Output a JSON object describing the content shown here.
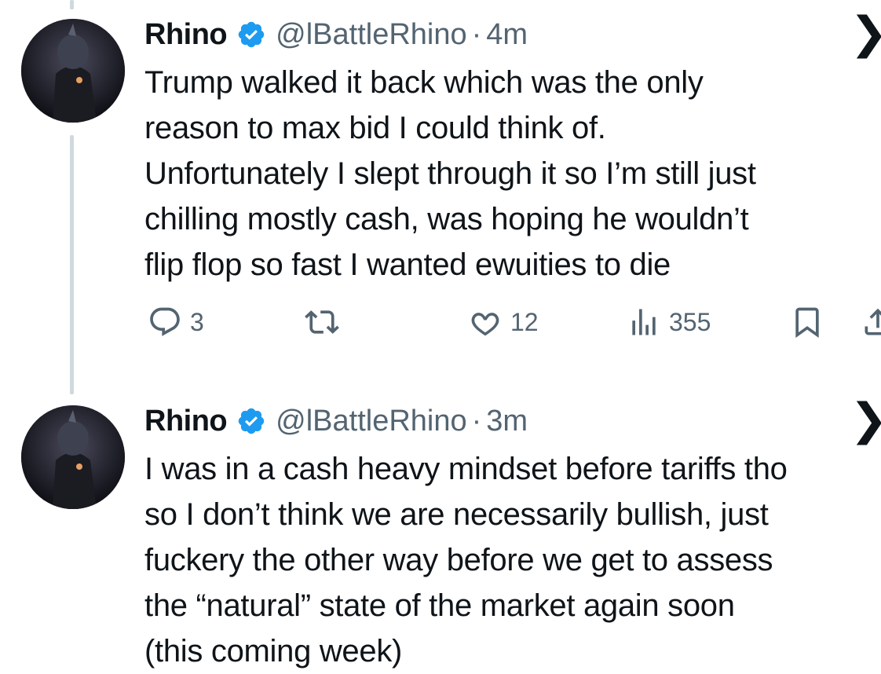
{
  "tweets": [
    {
      "name": "Rhino",
      "handle": "@lBattleRhino",
      "dot": "·",
      "time": "4m",
      "text": "Trump walked it back which was the only\nreason to max bid I could think of.\nUnfortunately I slept through it so I’m still just\nchilling mostly cash, was hoping he wouldn’t\nflip flop so fast I wanted ewuities to die",
      "stats": {
        "replies": "3",
        "retweets": "",
        "likes": "12",
        "views": "355"
      }
    },
    {
      "name": "Rhino",
      "handle": "@lBattleRhino",
      "dot": "·",
      "time": "3m",
      "text": "I was in a cash heavy mindset before tariffs tho\nso I don’t think we are necessarily bullish, just\nfuckery the other way before we get to assess\nthe “natural” state of the market again soon\n(this coming week)"
    }
  ],
  "icons": {
    "verified": "verified-badge-icon",
    "more": "more-chevron-icon",
    "reply": "reply-icon",
    "retweet": "retweet-icon",
    "like": "heart-icon",
    "views": "views-icon",
    "bookmark": "bookmark-icon",
    "share": "share-icon"
  },
  "colors": {
    "verified": "#1d9bf0",
    "secondary_text": "#536471",
    "thread_line": "#cfd9de"
  }
}
